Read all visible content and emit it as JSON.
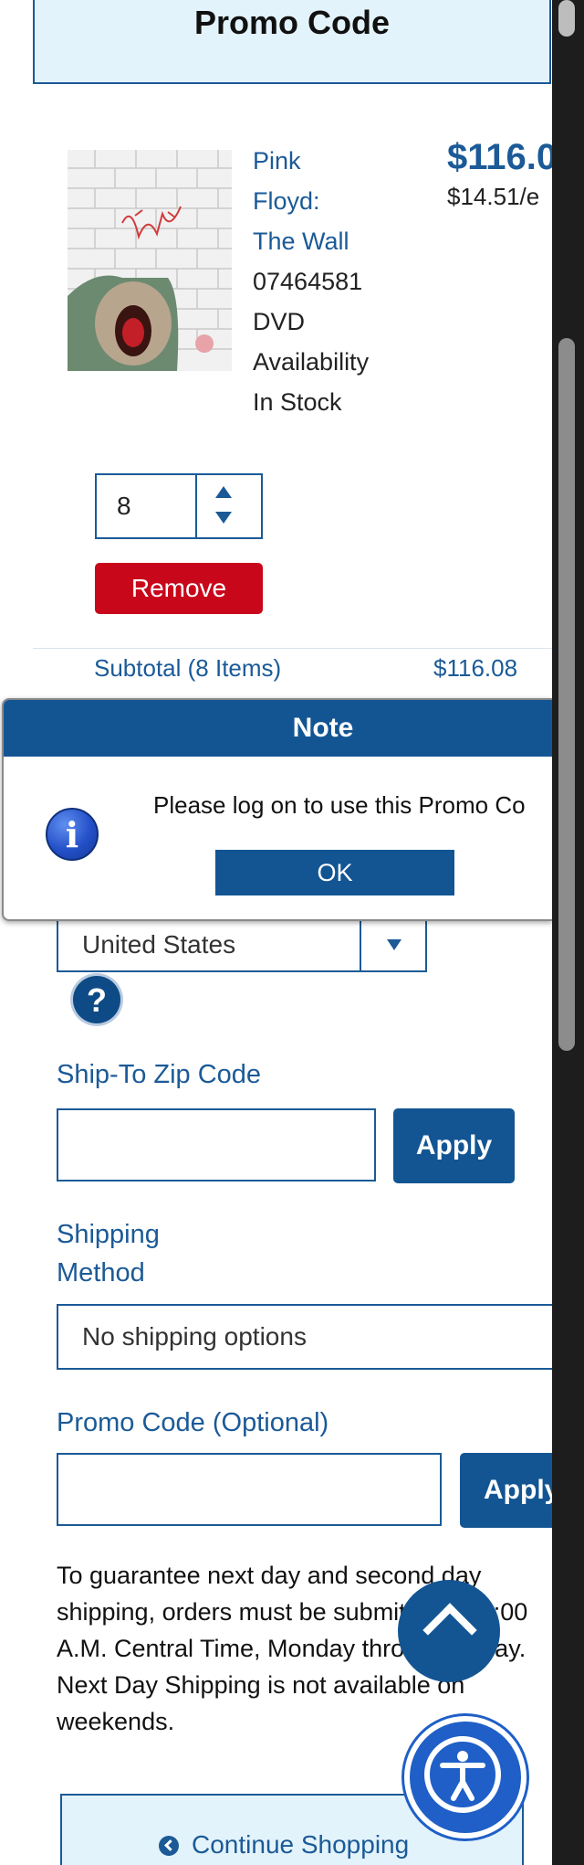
{
  "banner": {
    "title": "Promo Code"
  },
  "product": {
    "name_lines": [
      "Pink",
      "Floyd:",
      "The Wall"
    ],
    "sku": "07464581",
    "format": "DVD",
    "availability_label": "Availability",
    "stock_status": "In Stock",
    "price": "$116.0",
    "unit_price": "$14.51/e",
    "quantity": "8",
    "remove_label": "Remove"
  },
  "subtotal": {
    "label": "Subtotal (8 Items)",
    "value": "$116.08"
  },
  "modal": {
    "title": "Note",
    "message": "Please log on to use this Promo Co",
    "ok_label": "OK",
    "icon": "info-icon"
  },
  "country": {
    "selected": "United States"
  },
  "zip": {
    "label": "Ship-To Zip Code",
    "apply_label": "Apply",
    "value": ""
  },
  "shipping": {
    "label_line1": "Shipping",
    "label_line2": "Method",
    "selected": "No shipping options"
  },
  "promo": {
    "label": "Promo Code (Optional)",
    "apply_label": "Apply",
    "value": ""
  },
  "note": "To guarantee next day and second day shipping, orders must be submitted by 9:00 A.M. Central Time, Monday through Friday. Next Day Shipping is not available on weekends.",
  "continue": {
    "label": "Continue Shopping"
  },
  "colors": {
    "brand_blue": "#135593",
    "remove_red": "#c8071b",
    "banner_bg": "#e3f3fb"
  }
}
